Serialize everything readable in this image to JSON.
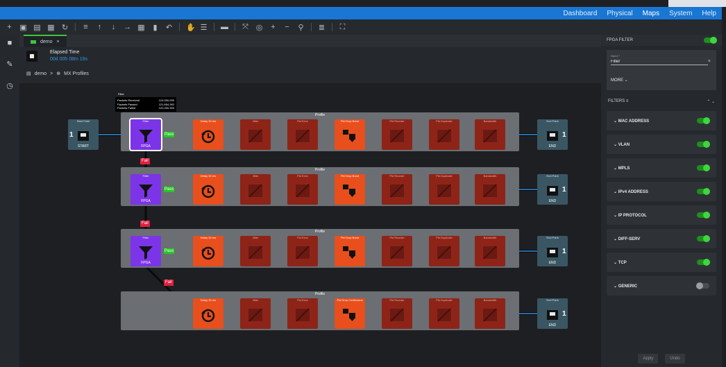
{
  "topnav": {
    "items": [
      "Dashboard",
      "Physical",
      "Maps",
      "System",
      "Help"
    ],
    "active": "Maps"
  },
  "toolbar": {
    "icons": [
      "add-icon",
      "save-icon",
      "save-as-icon",
      "export-icon",
      "refresh-icon",
      "align-icon",
      "arrow-up-icon",
      "arrow-down-icon",
      "arrow-right-icon",
      "grid-icon",
      "delete-icon",
      "undo-icon",
      "hand-icon",
      "list-icon",
      "link-icon",
      "fit-icon",
      "center-icon",
      "zoom-in-icon",
      "zoom-out-icon",
      "zoom-icon",
      "menu-icon",
      "expand-icon"
    ]
  },
  "tab": {
    "label": "demo",
    "close": "×"
  },
  "elapsed": {
    "label": "Elapsed Time",
    "value": "00d 00h 08m 18s"
  },
  "breadcrumb": {
    "root": "demo",
    "separator": ">",
    "current": "MX Profiles"
  },
  "tooltip": {
    "title": "Filter",
    "rows": [
      {
        "label": "Packets Received",
        "value": "124,000,000"
      },
      {
        "label": "Packets Passed",
        "value": "121,654,392"
      },
      {
        "label": "Packets Failed",
        "value": "122,000,300"
      }
    ]
  },
  "labels": {
    "pass": "Pass",
    "fail": "Fail",
    "profile": "Profile",
    "fpga": "FPGA",
    "start": "START",
    "end": "END",
    "port_count": "1"
  },
  "profiles": [
    {
      "nodes": [
        "Filter",
        "Delay 30 ms",
        "Jitter",
        "Pkt Error",
        "Pkt Drop Burst",
        "Pkt Reorder",
        "Pkt Duplicate",
        "Bandwidth"
      ]
    },
    {
      "nodes": [
        "Filter",
        "Delay 30 ms",
        "Jitter",
        "Pkt Error",
        "Pkt Drop Burst",
        "Pkt Reorder",
        "Pkt Duplicate",
        "Bandwidth"
      ]
    },
    {
      "nodes": [
        "Filter",
        "Delay 30 ms",
        "Jitter",
        "Pkt Error",
        "Pkt Drop Burst",
        "Pkt Reorder",
        "Pkt Duplicate",
        "Bandwidth"
      ]
    },
    {
      "nodes": [
        "Delay 30 ms",
        "Jitter",
        "Pkt Error",
        "Pkt Drop Continuous",
        "Pkt Reorder",
        "Pkt Duplicate",
        "Bandwidth"
      ]
    }
  ],
  "endpoints": {
    "start": "Start Point",
    "end": "End Point"
  },
  "panel": {
    "title": "FPGA FILTER",
    "name_label": "Name *",
    "name_value": "Filter",
    "clear": "×",
    "more": "MORE ⌄",
    "filters_title": "FILTERS",
    "filters": [
      {
        "label": "MAC ADDRESS",
        "on": true
      },
      {
        "label": "VLAN",
        "on": true
      },
      {
        "label": "MPLS",
        "on": true
      },
      {
        "label": "IPv4 ADDRESS",
        "on": true
      },
      {
        "label": "IP PROTOCOL",
        "on": true
      },
      {
        "label": "DIFF-SERV",
        "on": true
      },
      {
        "label": "TCP",
        "on": true
      },
      {
        "label": "GENERIC",
        "on": false
      }
    ],
    "apply": "Apply",
    "undo": "Undo"
  },
  "colors": {
    "accent": "#1976d2",
    "pass": "#25c725",
    "fail": "#e11f40",
    "active_node": "#e84f1d",
    "filter_node": "#7c34e8",
    "inactive_node": "#8e2418",
    "endpoint": "#3a5663"
  }
}
